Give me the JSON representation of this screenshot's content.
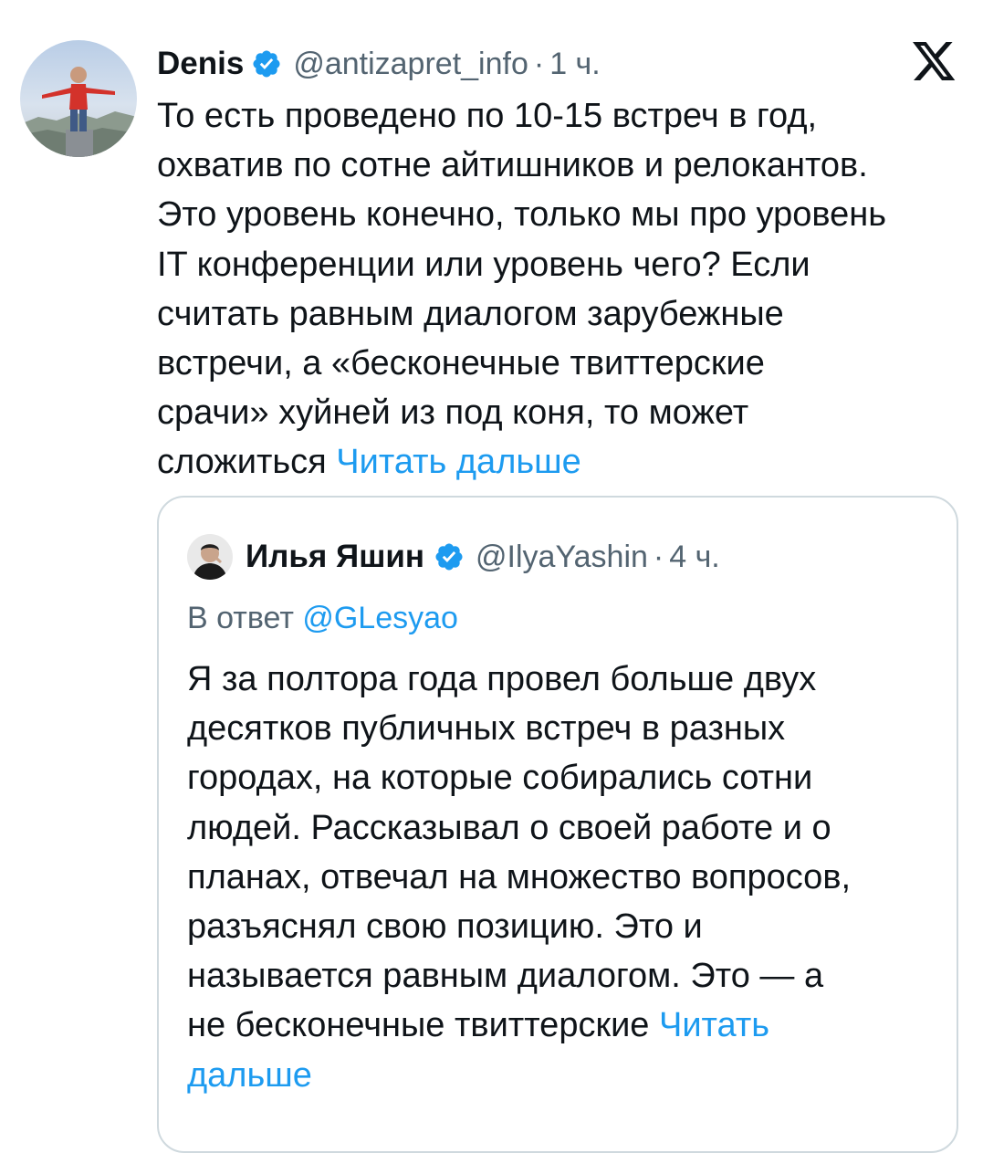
{
  "tweet": {
    "author_name": "Denis",
    "author_handle": "@antizapret_info",
    "separator": "·",
    "time": "1 ч.",
    "text": "То есть проведено по 10-15 встреч в год,\nохватив по сотне айтишников и релокантов.\nЭто уровень конечно, только мы про уровень\nIT конференции или уровень чего? Если\nсчитать равным диалогом зарубежные\nвстречи, а «бесконечные твиттерские\nсрачи» хуйней из под коня, то может\nсложиться ",
    "read_more": "Читать дальше",
    "verified_icon": "verified-badge-icon",
    "platform_icon": "x-logo-icon"
  },
  "quoted": {
    "author_name": "Илья Яшин",
    "author_handle": "@IlyaYashin",
    "separator": "·",
    "time": "4 ч.",
    "reply_prefix": "В ответ ",
    "reply_handle": "@GLesyao",
    "text": "Я за полтора года провел больше двух\nдесятков публичных встреч в разных\nгородах, на которые собирались сотни\nлюдей. Рассказывал о своей работе и о\nпланах, отвечал на множество вопросов,\nразъяснял свою позицию. Это и\nназывается равным диалогом. Это — а\nне бесконечные твиттерские ",
    "read_more": "Читать\nдальше"
  },
  "colors": {
    "link": "#1d9bf0",
    "verified": "#1d9bf0",
    "secondary_text": "#536471",
    "primary_text": "#0f1419",
    "border": "#cfd9de"
  }
}
